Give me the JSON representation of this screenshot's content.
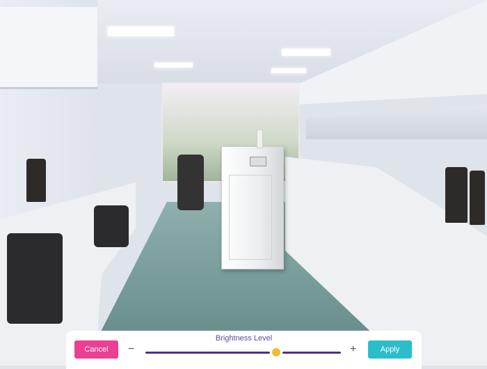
{
  "panel": {
    "title": "Brightness Level",
    "cancel_label": "Cancel",
    "apply_label": "Apply",
    "minus_label": "−",
    "plus_label": "+",
    "brightness_value": 0.67
  },
  "colors": {
    "cancel": "#ea3f93",
    "apply": "#2cbdcb",
    "track": "#4a2f8f",
    "thumb": "#f3bb2f",
    "title": "#5b4a9a"
  }
}
